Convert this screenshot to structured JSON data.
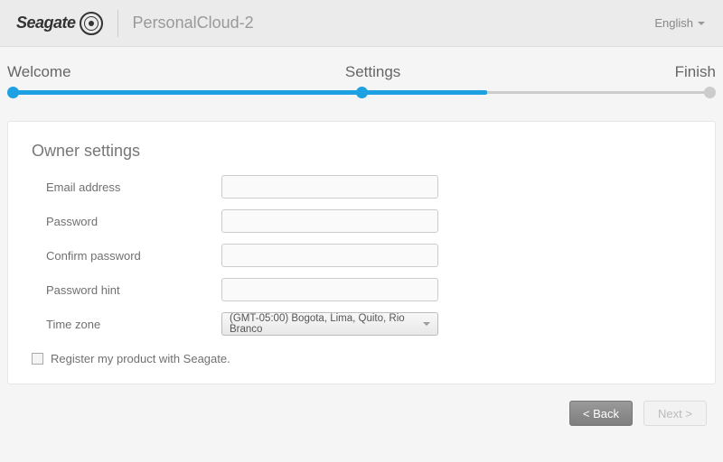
{
  "header": {
    "brand": "Seagate",
    "device": "PersonalCloud-2",
    "language": "English"
  },
  "wizard": {
    "steps": [
      "Welcome",
      "Settings",
      "Finish"
    ],
    "current_index": 1
  },
  "card": {
    "title": "Owner settings",
    "fields": {
      "email_label": "Email address",
      "email_value": "",
      "password_label": "Password",
      "password_value": "",
      "confirm_label": "Confirm password",
      "confirm_value": "",
      "hint_label": "Password hint",
      "hint_value": "",
      "tz_label": "Time zone",
      "tz_value": "(GMT-05:00) Bogota, Lima, Quito, Rio Branco"
    },
    "register_label": "Register my product with Seagate.",
    "register_checked": false
  },
  "buttons": {
    "back": "< Back",
    "next": "Next >"
  }
}
